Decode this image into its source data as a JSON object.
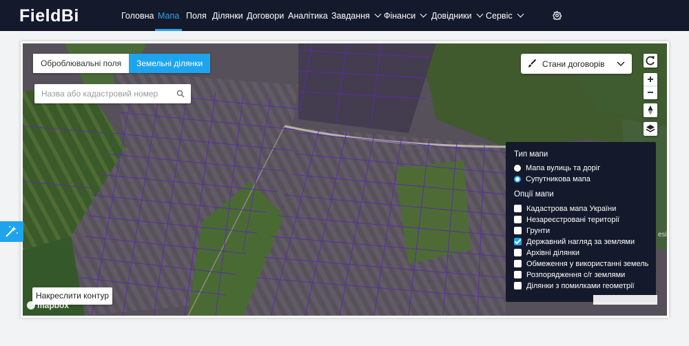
{
  "app": {
    "logo_main": "FieldB",
    "logo_accent": "i"
  },
  "nav": [
    {
      "label": "Головна",
      "active": false,
      "dropdown": false
    },
    {
      "label": "Мапа",
      "active": true,
      "dropdown": false
    },
    {
      "label": "Поля",
      "active": false,
      "dropdown": false
    },
    {
      "label": "Ділянки",
      "active": false,
      "dropdown": false
    },
    {
      "label": "Договори",
      "active": false,
      "dropdown": false
    },
    {
      "label": "Аналітика",
      "active": false,
      "dropdown": false
    },
    {
      "label": "Завдання",
      "active": false,
      "dropdown": true
    },
    {
      "label": "Фінанси",
      "active": false,
      "dropdown": true
    },
    {
      "label": "Довідники",
      "active": false,
      "dropdown": true
    },
    {
      "label": "Сервіс",
      "active": false,
      "dropdown": true
    }
  ],
  "tabs": {
    "cultivated": "Оброблювальні поля",
    "land_plots": "Земельні ділянки"
  },
  "search": {
    "placeholder": "Назва або кадастровий номер"
  },
  "contracts_dropdown": {
    "label": "Стани договорів"
  },
  "layers": {
    "map_type_title": "Тип мапи",
    "map_types": [
      {
        "label": "Мапа вулиць та доріг",
        "selected": false
      },
      {
        "label": "Супутникова мапа",
        "selected": true
      }
    ],
    "options_title": "Опції мапи",
    "options": [
      {
        "label": "Кадастрова мапа України",
        "checked": false
      },
      {
        "label": "Незареєстровані території",
        "checked": false
      },
      {
        "label": "Грунти",
        "checked": false
      },
      {
        "label": "Державний нагляд за землями",
        "checked": true
      },
      {
        "label": "Архівні ділянки",
        "checked": false
      },
      {
        "label": "Обмеження у використанні земель",
        "checked": false
      },
      {
        "label": "Розпорядження с/г землями",
        "checked": false
      },
      {
        "label": "Ділянки з помилками геометрії",
        "checked": false
      }
    ]
  },
  "draw_button": {
    "label": "Накреслити контур"
  },
  "map_attribution": {
    "brand": "mapbox",
    "edge_text": "esi"
  },
  "colors": {
    "navbar": "#141a2b",
    "accent": "#1ea4ef",
    "parcel_outline": "#5a2ca8"
  }
}
